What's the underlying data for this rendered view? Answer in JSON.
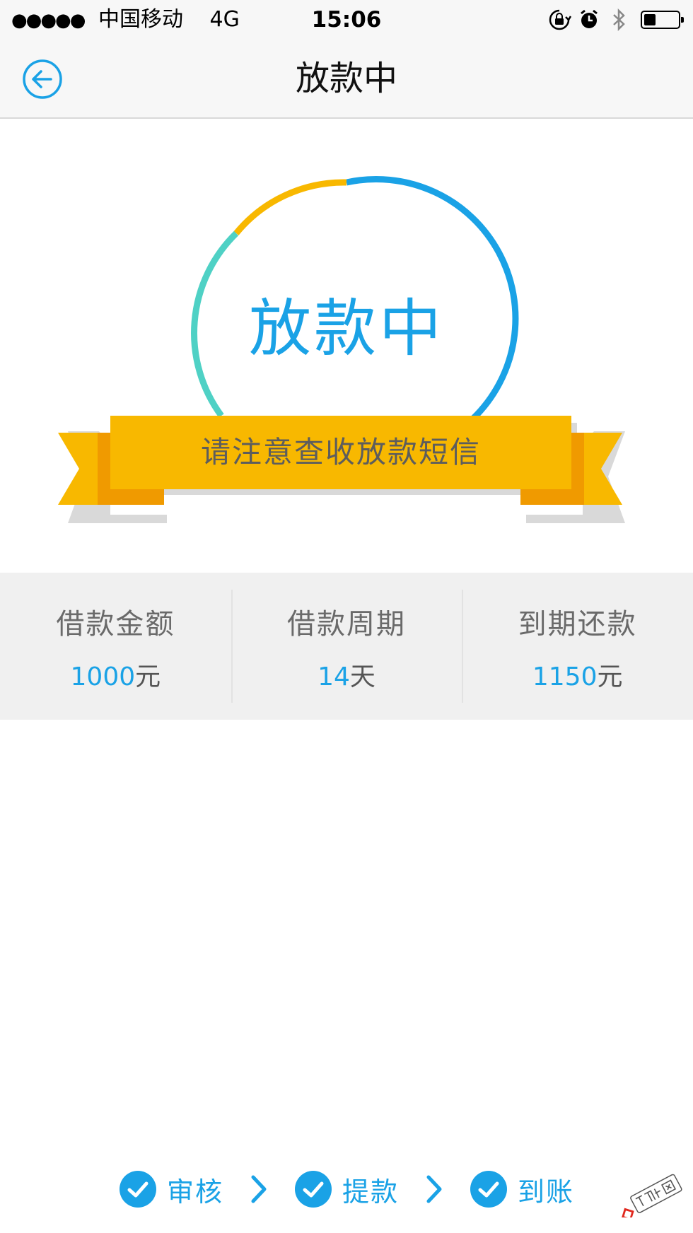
{
  "status_bar": {
    "carrier": "中国移动",
    "network": "4G",
    "time": "15:06",
    "battery_level": 0.35
  },
  "nav": {
    "title": "放款中"
  },
  "hero": {
    "status_text": "放款中",
    "ribbon_text": "请注意查收放款短信",
    "colors": {
      "blue": "#1aa2e6",
      "yellow": "#f8b800",
      "teal": "#4fd1c5",
      "ribbon": "#f8b800",
      "ribbon_dark": "#f09a00"
    }
  },
  "summary": [
    {
      "label": "借款金额",
      "value": "1000",
      "unit": "元"
    },
    {
      "label": "借款周期",
      "value": "14",
      "unit": "天"
    },
    {
      "label": "到期还款",
      "value": "1150",
      "unit": "元"
    }
  ],
  "steps": [
    {
      "label": "审核",
      "done": true
    },
    {
      "label": "提款",
      "done": true
    },
    {
      "label": "到账",
      "done": true
    }
  ],
  "watermark": {
    "text": "卡农社区"
  },
  "icons": {
    "back": "back-arrow-icon",
    "check": "check-circle-icon",
    "arrow": "chevron-right-icon"
  }
}
